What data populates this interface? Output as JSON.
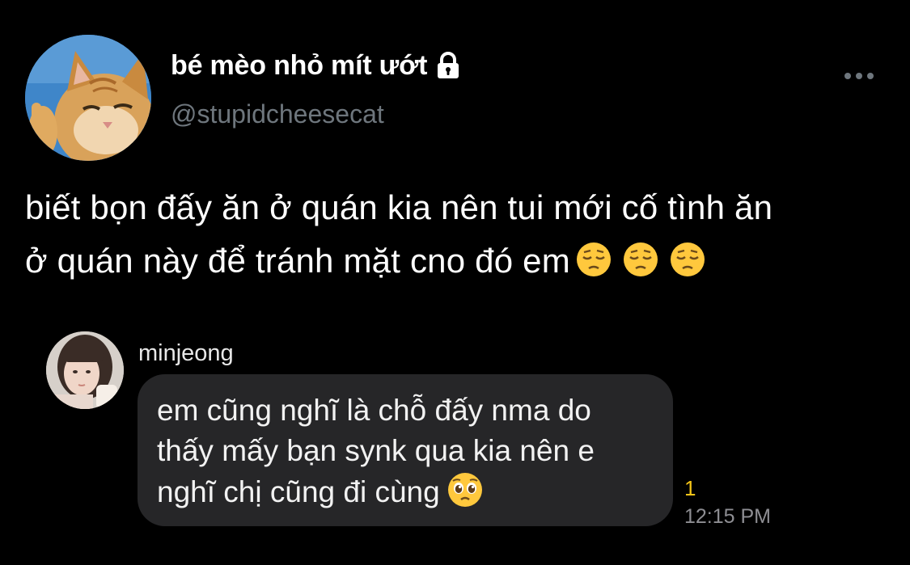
{
  "tweet": {
    "display_name": "bé mèo nhỏ mít ướt",
    "handle": "@stupidcheesecat",
    "text": "biết bọn đấy ăn ở quán kia nên tui mới cố tình ăn\nở quán này để tránh mặt cno đó em",
    "trailing_emojis": [
      "pensive-face",
      "pensive-face",
      "pensive-face"
    ],
    "avatar": "orange-cat-avatar",
    "lock_icon": "lock-icon",
    "more_icon": "more-horizontal-icon"
  },
  "reply": {
    "name": "minjeong",
    "message": "em cũng nghĩ là chỗ đấy nma do\nthấy mấy bạn synk qua kia nên e\nnghĩ chị cũng đi cùng",
    "trailing_emoji": "pleading-face",
    "read_count": "1",
    "time": "12:15 PM",
    "avatar": "girl-avatar"
  },
  "colors": {
    "background": "#000000",
    "text": "#ffffff",
    "handle": "#6e767d",
    "bubble": "#262628",
    "read_count": "#f5c518",
    "timestamp": "#8e8e93"
  }
}
